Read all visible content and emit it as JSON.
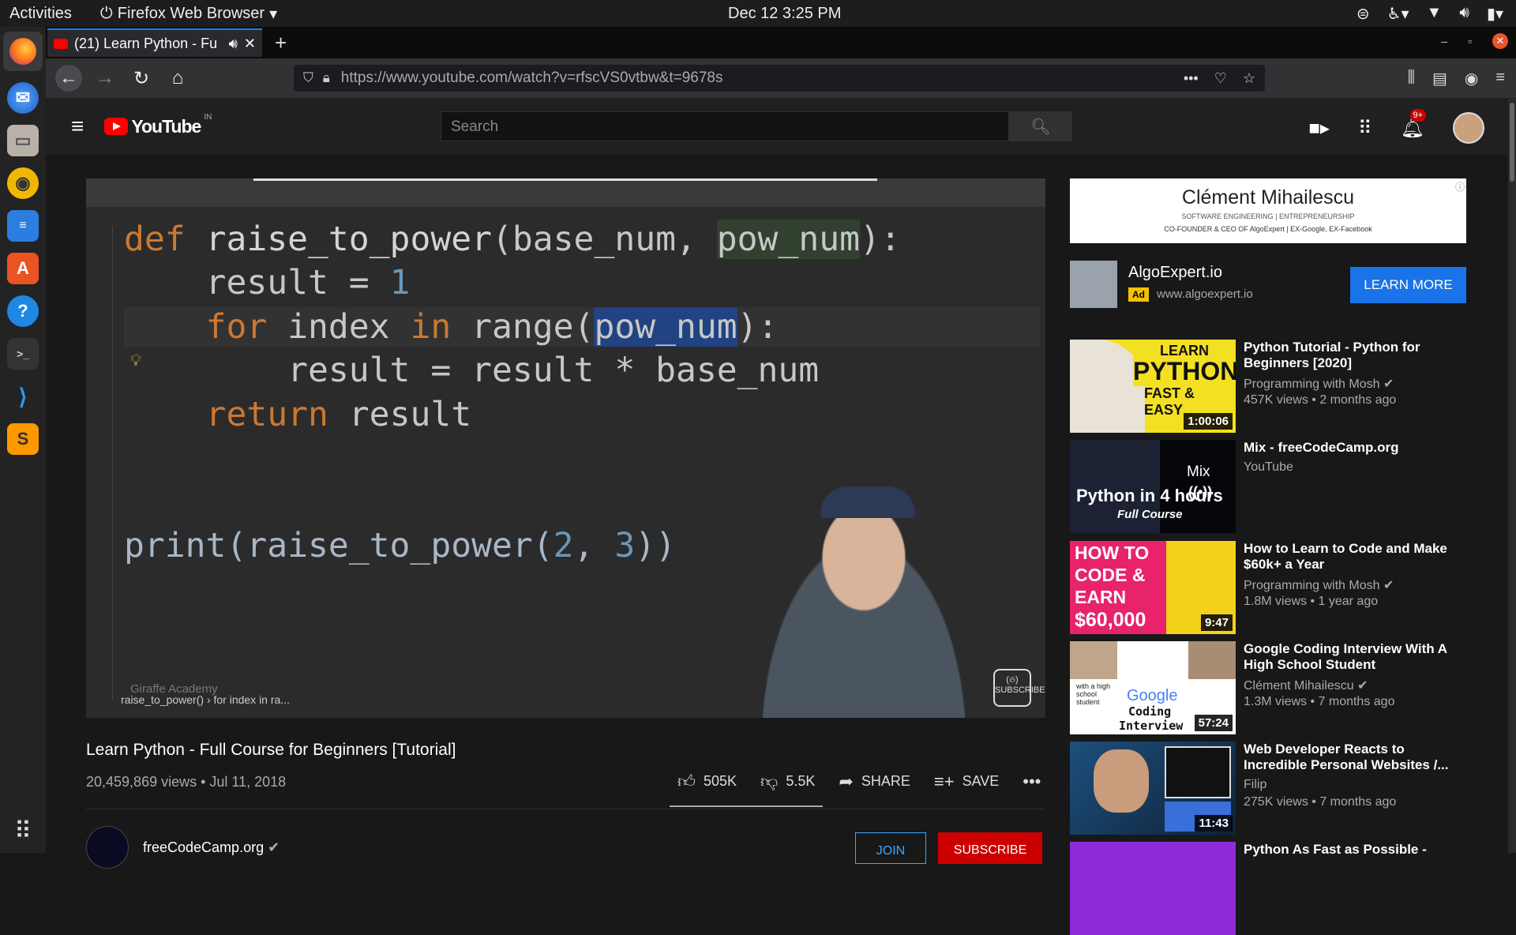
{
  "topbar": {
    "activities": "Activities",
    "app_name": "Firefox Web Browser",
    "clock": "Dec 12  3:25 PM"
  },
  "dock": {
    "items": [
      "firefox-icon",
      "thunderbird-icon",
      "files-icon",
      "rhythmbox-icon",
      "writer-icon",
      "software-icon",
      "help-icon",
      "terminal-icon",
      "vscode-icon",
      "sublime-icon"
    ]
  },
  "tab": {
    "title": "(21) Learn Python - Fu"
  },
  "urlbar": {
    "url": "https://www.youtube.com/watch?v=rfscVS0vtbw&t=9678s"
  },
  "yt": {
    "logo": "YouTube",
    "region": "IN",
    "search_placeholder": "Search",
    "notif_count": "9+"
  },
  "video": {
    "code_lines": [
      "def raise_to_power(base_num, pow_num):",
      "    result = 1",
      "    for index in range(pow_num):",
      "        result = result * base_num",
      "    return result",
      "print(raise_to_power(2, 3))"
    ],
    "watermark": "Giraffe Academy",
    "breadcrumb": "raise_to_power()  ›  for index in ra...",
    "logo_caption": "SUBSCRIBE",
    "title": "Learn Python - Full Course for Beginners [Tutorial]",
    "meta": "20,459,869 views • Jul 11, 2018",
    "likes": "505K",
    "dislikes": "5.5K",
    "share": "SHARE",
    "save": "SAVE",
    "like_ratio": 0.99
  },
  "channel": {
    "name": "freeCodeCamp.org",
    "join": "JOIN",
    "subscribe": "SUBSCRIBE"
  },
  "ad": {
    "banner_name": "Clément Mihailescu",
    "banner_sub1": "SOFTWARE ENGINEERING | ENTREPRENEURSHIP",
    "banner_sub2": "CO-FOUNDER & CEO OF AlgoExpert | EX-Google, EX-Facebook",
    "title": "AlgoExpert.io",
    "ad_label": "Ad",
    "url": "www.algoexpert.io",
    "cta": "LEARN MORE"
  },
  "recs": [
    {
      "title": "Python Tutorial - Python for Beginners [2020]",
      "channel": "Programming with Mosh",
      "views": "457K views • 2 months ago",
      "duration": "1:00:06",
      "thumb_text": [
        "LEARN",
        "PYTHON",
        "FAST & EASY"
      ]
    },
    {
      "title": "Mix - freeCodeCamp.org",
      "channel": "YouTube",
      "views": "",
      "duration": "",
      "thumb_text": [
        "Python in 4 hours",
        "Full Course",
        "Mix"
      ]
    },
    {
      "title": "How to Learn to Code and Make $60k+ a Year",
      "channel": "Programming with Mosh",
      "views": "1.8M views • 1 year ago",
      "duration": "9:47",
      "thumb_text": [
        "HOW TO",
        "CODE &",
        "EARN",
        "$60,000"
      ]
    },
    {
      "title": "Google Coding Interview With A High School Student",
      "channel": "Clément Mihailescu",
      "views": "1.3M views • 7 months ago",
      "duration": "57:24",
      "thumb_text": [
        "Google",
        "Coding",
        "Interview",
        "with a high school student"
      ]
    },
    {
      "title": "Web Developer Reacts to Incredible Personal Websites /...",
      "channel": "Filip",
      "views": "275K views • 7 months ago",
      "duration": "11:43",
      "thumb_text": []
    },
    {
      "title": "Python As Fast as Possible -",
      "channel": "",
      "views": "",
      "duration": "",
      "thumb_text": []
    }
  ]
}
